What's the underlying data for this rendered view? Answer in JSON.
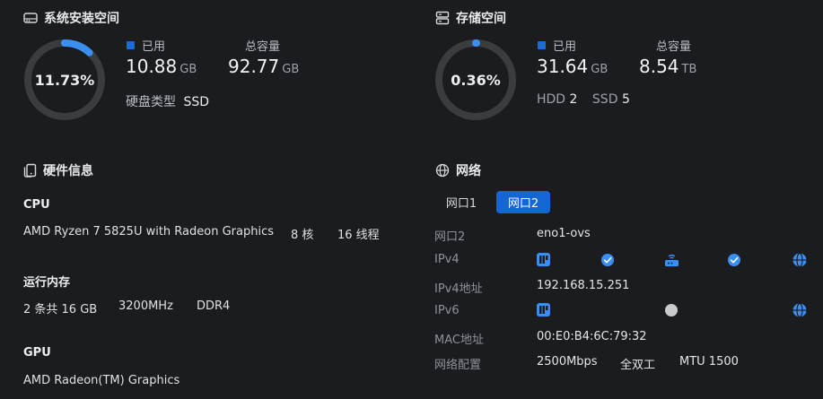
{
  "system_space": {
    "title": "系统安装空间",
    "percent_label": "11.73%",
    "percent": 11.73,
    "used_label": "已用",
    "used_value": "10.88",
    "used_unit": "GB",
    "total_label": "总容量",
    "total_value": "92.77",
    "total_unit": "GB",
    "disk_type_label": "硬盘类型",
    "disk_type_value": "SSD"
  },
  "storage_space": {
    "title": "存储空间",
    "percent_label": "0.36%",
    "percent": 0.36,
    "used_label": "已用",
    "used_value": "31.64",
    "used_unit": "GB",
    "total_label": "总容量",
    "total_value": "8.54",
    "total_unit": "TB",
    "hdd_label": "HDD",
    "hdd_count": "2",
    "ssd_label": "SSD",
    "ssd_count": "5"
  },
  "hardware": {
    "title": "硬件信息",
    "cpu_head": "CPU",
    "cpu_model": "AMD Ryzen 7 5825U with Radeon Graphics",
    "cpu_cores": "8 核",
    "cpu_threads": "16 线程",
    "mem_head": "运行内存",
    "mem_size": "2 条共 16 GB",
    "mem_speed": "3200MHz",
    "mem_type": "DDR4",
    "gpu_head": "GPU",
    "gpu_model": "AMD Radeon(TM) Graphics"
  },
  "network": {
    "title": "网络",
    "tabs": [
      {
        "label": "网口1",
        "active": false
      },
      {
        "label": "网口2",
        "active": true
      }
    ],
    "rows": {
      "port_key": "网口2",
      "port_val": "eno1-ovs",
      "ipv4_key": "IPv4",
      "ipv4_addr_key": "IPv4地址",
      "ipv4_addr_val": "192.168.15.251",
      "ipv6_key": "IPv6",
      "mac_key": "MAC地址",
      "mac_val": "00:E0:B4:6C:79:32",
      "config_key": "网络配置",
      "config_speed": "2500Mbps",
      "config_duplex": "全双工",
      "config_mtu": "MTU 1500"
    },
    "icons": {
      "ipv4_chain": [
        "nic-icon",
        "check-circle-icon",
        "router-icon",
        "check-circle-icon",
        "globe-icon"
      ],
      "ipv6_chain": [
        "nic-icon",
        "gray-dot-icon",
        "globe-icon"
      ]
    }
  },
  "colors": {
    "background": "#1b1c1f",
    "accent": "#1e6bd6",
    "ring_track": "#3a3c40",
    "ring_fill": "#3b8ff0"
  }
}
